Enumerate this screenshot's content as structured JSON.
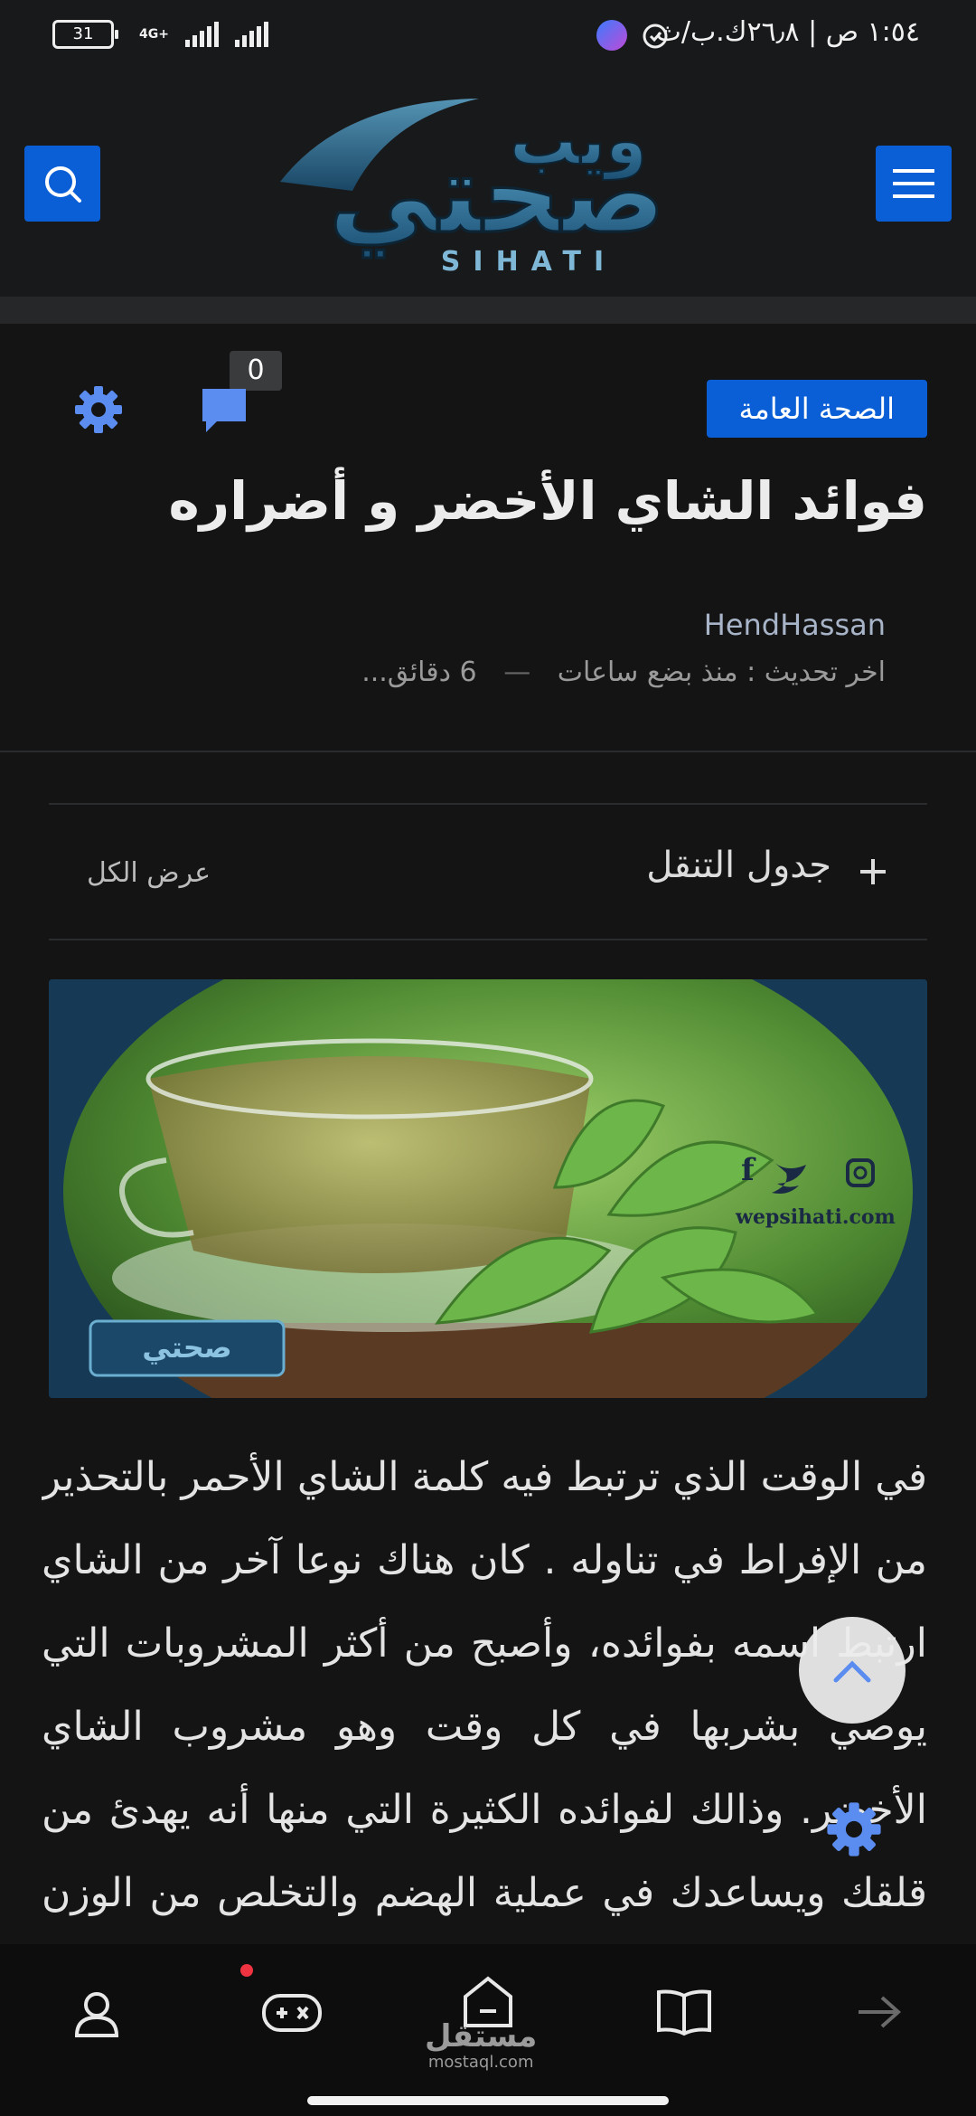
{
  "status_bar": {
    "time_text": "١:٥٤ ص | ٢٦٫٨ك.ب/ث",
    "network": "4G+",
    "battery": "31"
  },
  "header": {
    "logo_top": "ويب",
    "logo_main": "صحتي",
    "logo_sub": "SIHATI",
    "icons": {
      "menu": "hamburger-menu-icon",
      "search": "search-icon"
    },
    "accent_color": "#0a5fd6"
  },
  "article": {
    "category": "الصحة العامة",
    "comment_count": "0",
    "title": "فوائد الشاي الأخضر و أضراره",
    "author": "HendHassan",
    "update_label": "اخر تحديث : منذ بضع ساعات",
    "read_time": "6 دقائق...",
    "body": "في الوقت الذي ترتبط فيه كلمة الشاي الأحمر بالتحذير من الإفراط في تناوله . كان هناك نوعا آخر من الشاي ارتبط اسمه بفوائده، وأصبح من أكثر المشروبات التي يوصي بشربها في كل وقت وهو مشروب الشاي الأخضر. وذالك لفوائده الكثيرة التي منها أنه يهدئ من قلقك ويساعدك في عملية الهضم والتخلص من الوزن الزائد"
  },
  "toc": {
    "title": "جدول التنقل",
    "view_all": "عرض الكل"
  },
  "hero_image": {
    "website": "wepsihati.com",
    "social": [
      "facebook-icon",
      "twitter-icon",
      "instagram-icon"
    ]
  },
  "bottom_nav": {
    "items": [
      "profile-icon",
      "games-icon",
      "home-icon",
      "book-icon",
      "forward-arrow-icon"
    ],
    "watermark_ar": "مستقل",
    "watermark_en": "mostaql.com"
  }
}
